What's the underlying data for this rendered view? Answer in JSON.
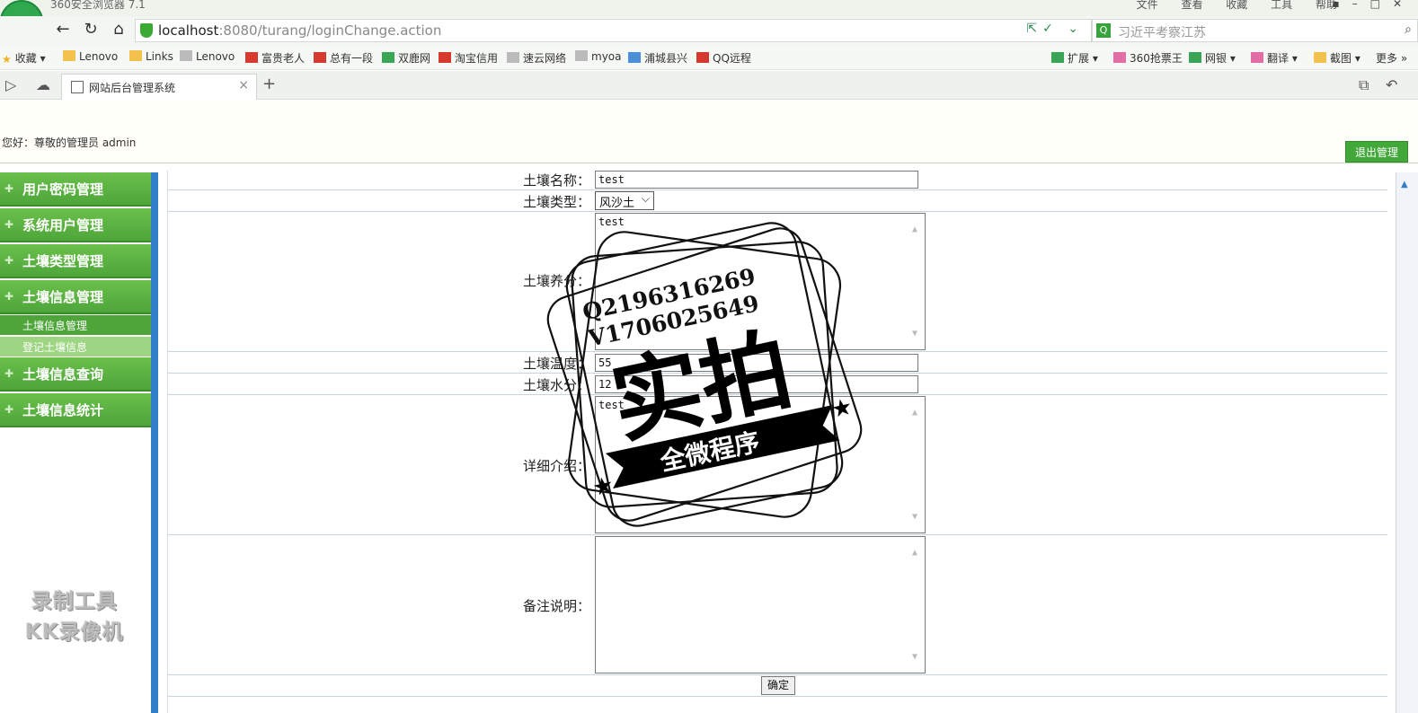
{
  "browser": {
    "title_text": "360安全浏览器 7.1",
    "menu_items": [
      "文件",
      "查看",
      "收藏",
      "工具",
      "帮助"
    ],
    "url_host": "localhost",
    "url_rest": ":8080/turang/loginChange.action",
    "search_placeholder": "习近平考察江苏",
    "bookmarks": {
      "favorites": "收藏",
      "lenovo1": "Lenovo",
      "links": "Links",
      "lenovo2": "Lenovo",
      "fugui": "富贵老人",
      "zongyou": "总有一段",
      "shuanglu": "双鹿网",
      "taobao": "淘宝信用",
      "suyun": "速云网络",
      "myoa": "myoa",
      "pucheng": "浦城县兴",
      "qq": "QQ远程",
      "extend": "扩展",
      "ticket": "360抢票王",
      "bank": "网银",
      "translate": "翻译",
      "screenshot": "截图",
      "more": "更多"
    },
    "tab_title": "网站后台管理系统"
  },
  "header": {
    "welcome": "您好：尊敬的管理员  admin",
    "logout_label": "退出管理"
  },
  "sidebar": {
    "items": [
      {
        "label": "用户密码管理"
      },
      {
        "label": "系统用户管理"
      },
      {
        "label": "土壤类型管理"
      },
      {
        "label": "土壤信息管理"
      },
      {
        "label": "土壤信息查询"
      },
      {
        "label": "土壤信息统计"
      }
    ],
    "subitems": [
      {
        "label": "土壤信息管理"
      },
      {
        "label": "登记土壤信息"
      }
    ]
  },
  "form": {
    "name_label": "土壤名称：",
    "name_value": "test",
    "type_label": "土壤类型：",
    "type_value": "风沙土",
    "nutrient_label": "土壤养分：",
    "nutrient_value": "test",
    "temp_label": "土壤温度：",
    "temp_value": "55",
    "moisture_label": "土壤水分：",
    "moisture_value": "12",
    "detail_label": "详细介绍：",
    "detail_value": "test",
    "remark_label": "备注说明：",
    "remark_value": "",
    "submit_label": "确定"
  },
  "overlay": {
    "stamp_line1": "Q2196316269",
    "stamp_line2": "V1706025649",
    "stamp_big": "实拍",
    "stamp_ribbon": "全微程序",
    "recorder_line1": "录制工具",
    "recorder_line2": "KK录像机"
  }
}
